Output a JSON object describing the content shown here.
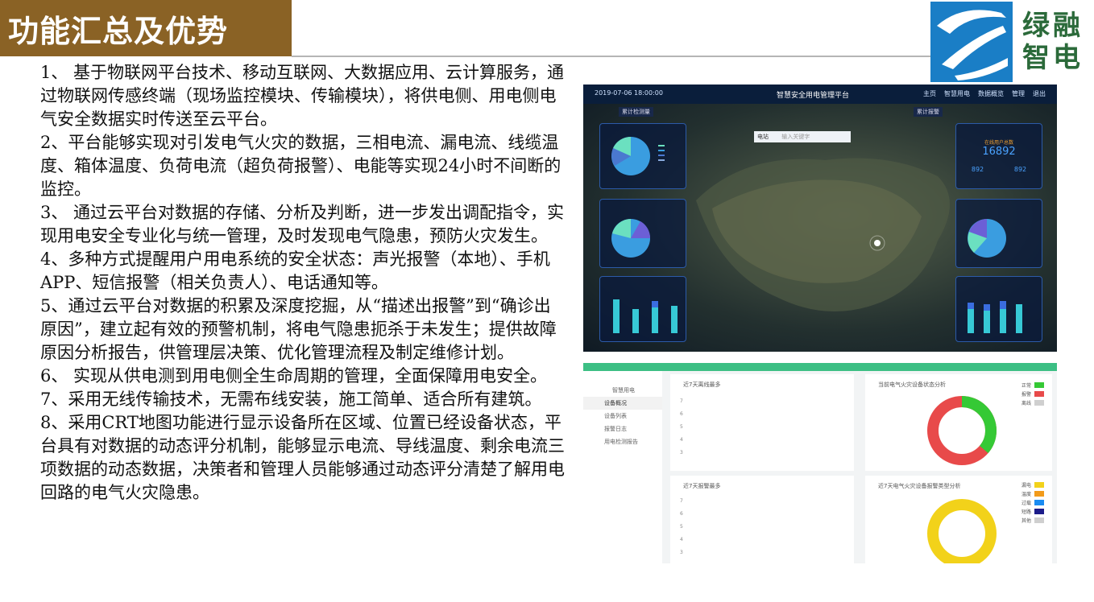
{
  "header": {
    "title": "功能汇总及优势",
    "brand_line1": "绿融",
    "brand_line2": "智电"
  },
  "items": [
    "1、 基于物联网平台技术、移动互联网、大数据应用、云计算服务，通过物联网传感终端（现场监控模块、传输模块），将供电侧、用电侧电气安全数据实时传送至云平台。",
    "2、平台能够实现对引发电气火灾的数据，三相电流、漏电流、线缆温度、箱体温度、负荷电流（超负荷报警）、电能等实现24小时不间断的监控。",
    "3、 通过云平台对数据的存储、分析及判断，进一步发出调配指令，实现用电安全专业化与统一管理，及时发现电气隐患，预防火灾发生。",
    "4、多种方式提醒用户用电系统的安全状态：声光报警（本地）、手机APP、短信报警（相关负责人）、电话通知等。",
    "5、通过云平台对数据的积累及深度挖掘，从“描述出报警”到“确诊出原因”，建立起有效的预警机制，将电气隐患扼杀于未发生；提供故障原因分析报告，供管理层决策、优化管理流程及制定维修计划。",
    "6、 实现从供电测到用电侧全生命周期的管理，全面保障用电安全。",
    "7、采用无线传输技术，无需布线安装，施工简单、适合所有建筑。",
    "8、采用CRT地图功能进行显示设备所在区域、位置已经设备状态，平台具有对数据的动态评分机制，能够显示电流、导线温度、剩余电流三项数据的动态数据，决策者和管理人员能够通过动态评分清楚了解用电回路的电气火灾隐患。"
  ],
  "dashboard": {
    "time": "2019-07-06 18:00:00",
    "title": "智慧安全用电管理平台",
    "nav": [
      "主页",
      "智慧用电",
      "数据概览",
      "管理",
      "退出"
    ],
    "counter_left_label": "累计检测量",
    "counter_right_label": "累计报警",
    "search_select": "电站",
    "search_placeholder": "输入关键字",
    "stat_label": "在线用户总数",
    "stat_value": "16892",
    "stat_left_value": "892",
    "stat_right_value": "892"
  },
  "device_page": {
    "sidebar": [
      "智慧用电",
      "设备概况",
      "设备列表",
      "报警日志",
      "用电检测报告"
    ],
    "card1_title": "近7天离线最多",
    "card2_title": "当前电气火灾设备状态分析",
    "card3_title": "近7天报警最多",
    "card4_title": "近7天电气火灾设备报警类型分析",
    "axis": [
      "7",
      "6",
      "5",
      "4",
      "3",
      "2",
      "1",
      "0"
    ],
    "legend_status": [
      {
        "label": "正常",
        "color": "#35c935"
      },
      {
        "label": "报警",
        "color": "#e84a4a"
      },
      {
        "label": "离线",
        "color": "#cfcfcf"
      }
    ],
    "legend_types": [
      {
        "label": "漏电",
        "color": "#f2d21a"
      },
      {
        "label": "温度",
        "color": "#f29b1a"
      },
      {
        "label": "过载",
        "color": "#1a8cf2"
      },
      {
        "label": "短路",
        "color": "#1c1c8a"
      },
      {
        "label": "其他",
        "color": "#cfcfcf"
      }
    ]
  }
}
